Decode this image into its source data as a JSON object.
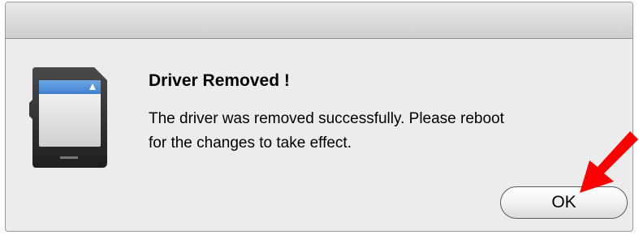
{
  "dialog": {
    "title": "Driver Removed !",
    "message_lines": [
      "The driver was removed successfully.  Please reboot",
      "for the changes to take effect."
    ],
    "ok_label": "OK",
    "icon": "sd-card-icon",
    "annotation_icon": "red-arrow-icon"
  },
  "colors": {
    "annotation_arrow": "#ff0000",
    "card_label": "#4f8ed6",
    "dialog_bg": "#ececec"
  }
}
